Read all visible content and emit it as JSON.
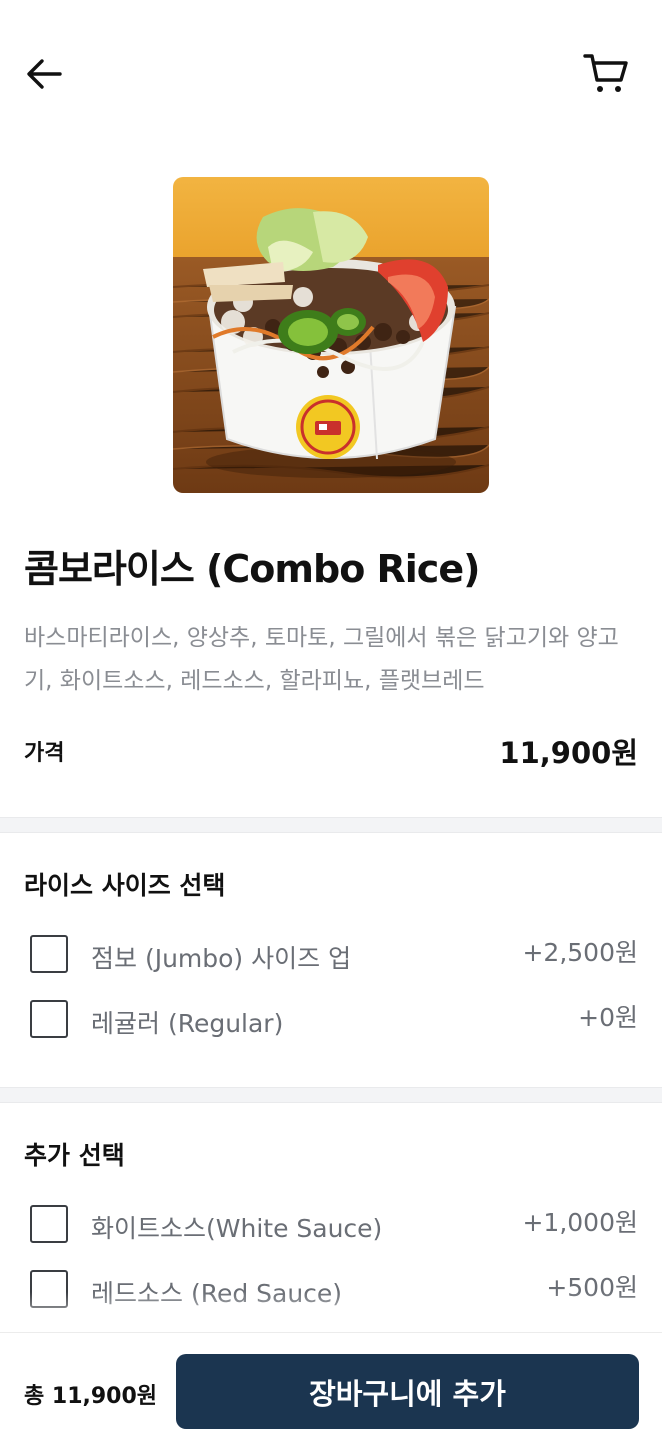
{
  "header": {
    "back_icon": "arrow-left-icon",
    "cart_icon": "cart-icon"
  },
  "product": {
    "image_icon": "rice-bowl-photo",
    "name": "콤보라이스 (Combo Rice)",
    "description": "바스마티라이스, 양상추, 토마토, 그릴에서 볶은 닭고기와 양고기, 화이트소스, 레드소스, 할라피뇨, 플랫브레드",
    "price_label": "가격",
    "price": "11,900원"
  },
  "rice_size": {
    "title": "라이스 사이즈 선택",
    "options": [
      {
        "label": "점보 (Jumbo) 사이즈 업",
        "price": "+2,500원",
        "checked": false
      },
      {
        "label": "레귤러 (Regular)",
        "price": "+0원",
        "checked": false
      }
    ]
  },
  "extras": {
    "title": "추가 선택",
    "options": [
      {
        "label": "화이트소스(White Sauce)",
        "price": "+1,000원",
        "checked": false
      },
      {
        "label": "레드소스 (Red Sauce)",
        "price": "+500원",
        "checked": false
      }
    ]
  },
  "footer": {
    "total": "총 11,900원",
    "add_to_cart": "장바구니에 추가"
  },
  "colors": {
    "primary_button": "#1b3550",
    "muted_text": "#8a8d93"
  }
}
